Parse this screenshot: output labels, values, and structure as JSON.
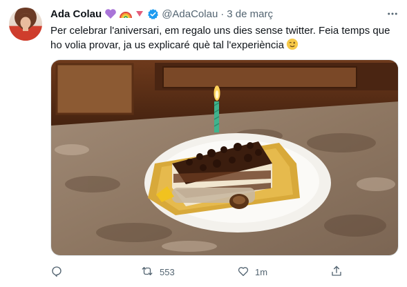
{
  "tweet": {
    "author_name": "Ada Colau",
    "author_handle": "@AdaColau",
    "separator": "·",
    "date": "3 de març",
    "text": "Per celebrar l'aniversari, em regalo uns dies sense twitter. Feia temps que ho volia provar, ja us explicaré què tal l'experiència",
    "name_emojis": [
      "purple-heart",
      "rainbow",
      "down-triangle"
    ],
    "verified": true
  },
  "actions": {
    "reply_count": "",
    "retweet_count": "553",
    "like_count": "1m",
    "share_count": ""
  },
  "colors": {
    "text": "#0f1419",
    "secondary": "#536471",
    "verified_blue": "#1d9bf0"
  }
}
